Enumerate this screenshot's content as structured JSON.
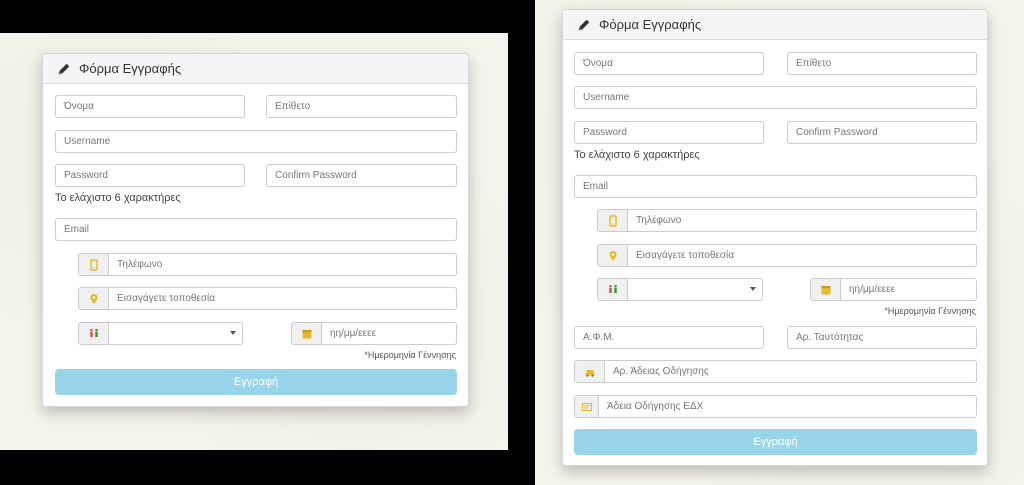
{
  "form": {
    "title": "Φόρμα Εγγραφής",
    "first_name_placeholder": "Όνομα",
    "last_name_placeholder": "Επίθετο",
    "username_placeholder": "Username",
    "password_placeholder": "Password",
    "confirm_password_placeholder": "Confirm Password",
    "password_hint": "Το ελάχιστο 6 χαρακτήρες",
    "email_placeholder": "Email",
    "phone_placeholder": "Τηλέφωνο",
    "location_placeholder": "Εισαγάγετε τοποθεσία",
    "gender_selected": "",
    "birthdate_placeholder": "ηη/μμ/εεεε",
    "birthdate_note": "*Ημερομηνία Γέννησης",
    "submit_label": "Εγγραφή"
  },
  "form_extended": {
    "afm_placeholder": "Α.Φ.Μ.",
    "id_placeholder": "Αρ. Ταυτότητας",
    "license_placeholder": "Αρ. Άδειας Οδήγησης",
    "edx_license_placeholder": "Άδεια Οδήγησης ΕΔΧ"
  },
  "colors": {
    "submit_button": "#99d5ea",
    "icon_accent": "#e8b92c",
    "gender_green": "#3a9a3a",
    "gender_red": "#d9534f"
  },
  "icons": {
    "header": "pencil-icon",
    "phone": "mobile-phone-icon",
    "location": "map-marker-icon",
    "gender": "male-female-icon",
    "calendar": "calendar-icon",
    "license": "taxi-car-icon",
    "edx": "id-card-icon"
  }
}
